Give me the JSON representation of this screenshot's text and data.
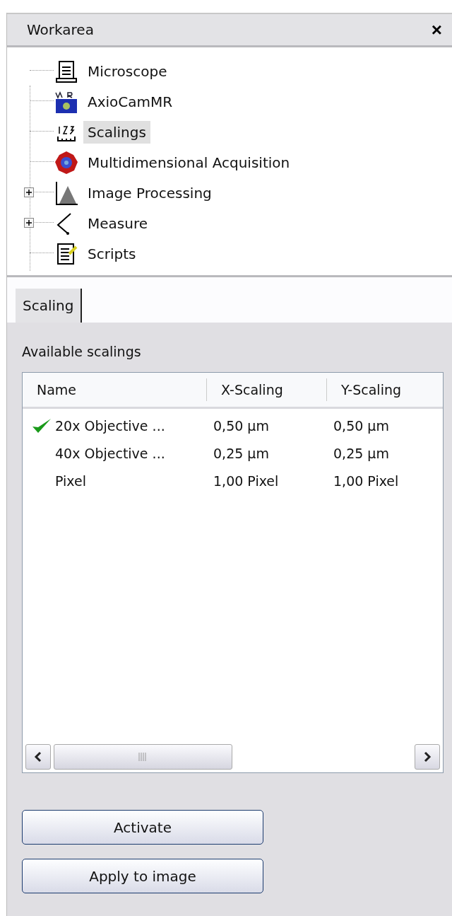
{
  "panel": {
    "title": "Workarea",
    "close": "×"
  },
  "tree": [
    {
      "label": "Microscope",
      "kind": "microscope",
      "selected": false
    },
    {
      "label": "AxioCamMR",
      "kind": "camera",
      "selected": false
    },
    {
      "label": "Scalings",
      "kind": "scale",
      "selected": true
    },
    {
      "label": "Multidimensional Acquisition",
      "kind": "cell",
      "selected": false
    },
    {
      "label": "Image Processing",
      "kind": "histogram",
      "selected": false,
      "expanded": false
    },
    {
      "label": "Measure",
      "kind": "angle",
      "selected": false,
      "expanded": false
    },
    {
      "label": "Scripts",
      "kind": "script",
      "selected": false
    }
  ],
  "tabs": [
    {
      "label": "Scaling",
      "selected": true
    }
  ],
  "section_label": "Available scalings",
  "table": {
    "columns": [
      "Name",
      "X-Scaling",
      "Y-Scaling"
    ],
    "rows": [
      {
        "cells": [
          "20x Objective ...",
          "0,50 µm",
          "0,50 µm"
        ],
        "active": true
      },
      {
        "cells": [
          "40x Objective ...",
          "0,25 µm",
          "0,25 µm"
        ],
        "active": false
      },
      {
        "cells": [
          "Pixel",
          "1,00 Pixel",
          "1,00 Pixel"
        ],
        "active": false
      }
    ]
  },
  "buttons": [
    "Activate",
    "Apply to image"
  ]
}
